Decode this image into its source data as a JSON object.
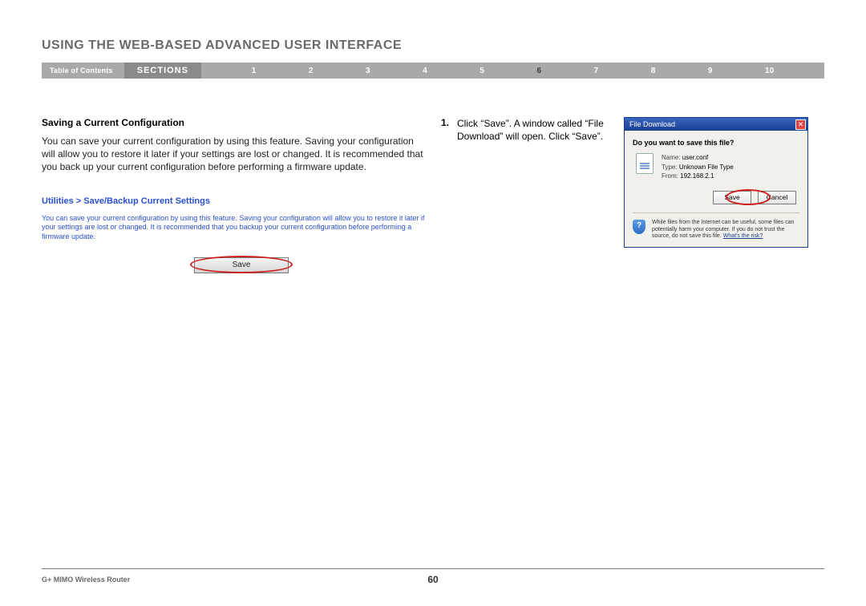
{
  "chapter_title": "USING THE WEB-BASED ADVANCED USER INTERFACE",
  "nav": {
    "toc": "Table of Contents",
    "sections_label": "SECTIONS",
    "numbers": [
      "1",
      "2",
      "3",
      "4",
      "5",
      "6",
      "7",
      "8",
      "9",
      "10"
    ],
    "active_index": 5
  },
  "section": {
    "heading": "Saving a Current Configuration",
    "body": "You can save your current configuration by using this feature. Saving your configuration will allow you to restore it later if your settings are lost or changed. It is recommended that you back up your current configuration before performing a firmware update."
  },
  "step": {
    "num": "1.",
    "text": "Click “Save”. A window called “File Download” will open. Click “Save”."
  },
  "utilities": {
    "title": "Utilities > Save/Backup Current Settings",
    "desc": "You can save your current configuration by using this feature. Saving your configuration will allow you to restore it later if your settings are lost or changed. It is recommended that you backup your current configuration before performing a firmware update.",
    "save_label": "Save"
  },
  "dialog": {
    "title": "File Download",
    "question": "Do you want to save this file?",
    "name_lbl": "Name:",
    "name_val": "user.conf",
    "type_lbl": "Type:",
    "type_val": "Unknown File Type",
    "from_lbl": "From:",
    "from_val": "192.168.2.1",
    "save_btn": "Save",
    "cancel_btn": "Cancel",
    "warning": "While files from the Internet can be useful, some files can potentially harm your computer. If you do not trust the source, do not save this file.",
    "risk_link": "What's the risk?"
  },
  "footer": {
    "product": "G+ MIMO Wireless Router",
    "page": "60"
  }
}
